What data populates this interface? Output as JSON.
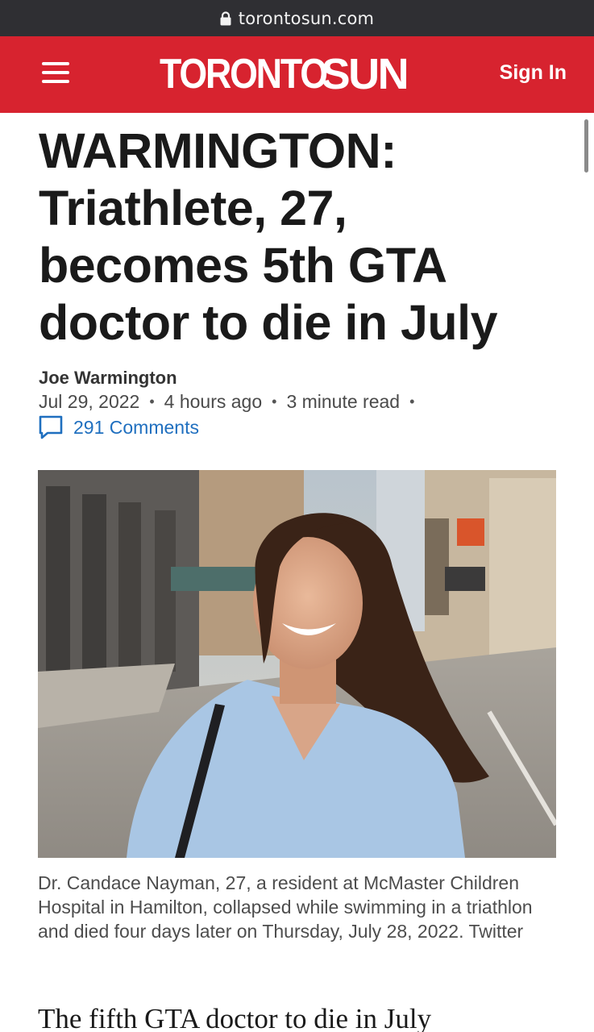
{
  "browser": {
    "url": "torontosun.com",
    "lock_icon": "lock-icon"
  },
  "header": {
    "menu_icon": "hamburger-menu-icon",
    "logo_part1": "TORONTO",
    "logo_part2": "SUN",
    "signin_label": "Sign In",
    "brand_color": "#d7232f"
  },
  "article": {
    "headline": "WARMINGTON: Triathlete, 27, becomes 5th GTA doctor to die in July",
    "author": "Joe Warmington",
    "date": "Jul 29, 2022",
    "time_ago": "4 hours ago",
    "read_time": "3 minute read",
    "comments_label": "291 Comments",
    "comments_icon": "speech-bubble-icon",
    "caption": "Dr. Candace Nayman, 27, a resident at McMaster Children Hospital in Hamilton, collapsed while swimming in a triathlon and died four days later on Thursday, July 28, 2022. Twitter",
    "body_first_line": "The fifth GTA doctor to die in July"
  }
}
